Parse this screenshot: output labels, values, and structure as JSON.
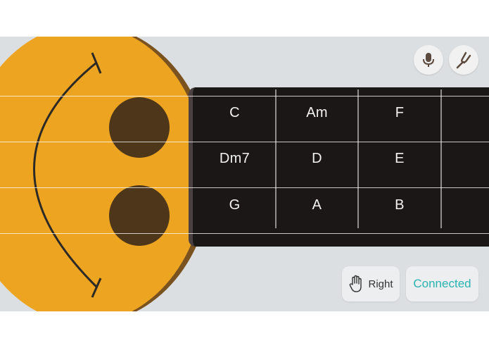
{
  "colors": {
    "background": "#dcdfe1",
    "body": "#eda521",
    "body_rim": "#7a5220",
    "sound_holes": "#4d3619",
    "fretboard": "#1c1717",
    "chord_text": "#f2f2f2",
    "connected_accent": "#2ab3b1"
  },
  "chords": {
    "rows": [
      [
        "C",
        "Am",
        "F",
        ""
      ],
      [
        "Dm7",
        "D",
        "E",
        ""
      ],
      [
        "G",
        "A",
        "B",
        ""
      ]
    ]
  },
  "toolbar": {
    "mic_icon": "microphone-icon",
    "tuner_icon": "tuning-fork-icon"
  },
  "hand_toggle": {
    "icon": "hand-icon",
    "label": "Right"
  },
  "connection": {
    "label": "Connected"
  }
}
